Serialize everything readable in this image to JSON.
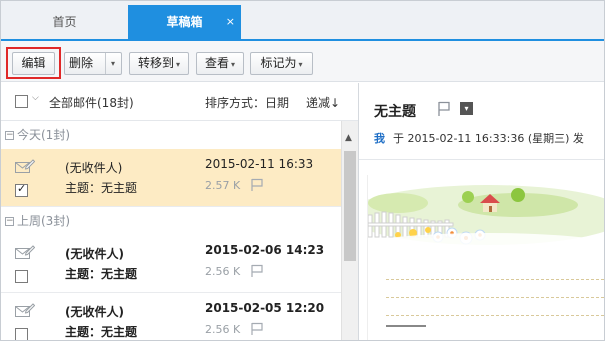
{
  "tabs": {
    "home_label": "首页",
    "drafts_label": "草稿箱",
    "close_glyph": "×"
  },
  "toolbar": {
    "edit_label": "编辑",
    "delete_label": "删除",
    "move_label": "转移到",
    "view_label": "查看",
    "mark_label": "标记为",
    "caret": "▾"
  },
  "list_header": {
    "select_all_label": "全部邮件(18封)",
    "sort_label": "排序方式：日期",
    "order_label": "递减↓"
  },
  "groups": [
    {
      "label": "今天(1封)",
      "toggle": "−"
    },
    {
      "label": "上周(3封)",
      "toggle": "−"
    }
  ],
  "mails": [
    {
      "recipient": "(无收件人)",
      "subject": "主题：无主题",
      "date": "2015-02-11 16:33",
      "size": "2.57 K",
      "checked": true,
      "selected": true,
      "unread": false
    },
    {
      "recipient": "(无收件人)",
      "subject": "主题：无主题",
      "date": "2015-02-06 14:23",
      "size": "2.56 K",
      "checked": false,
      "selected": false,
      "unread": true
    },
    {
      "recipient": "(无收件人)",
      "subject": "主题：无主题",
      "date": "2015-02-05 12:20",
      "size": "2.56 K",
      "checked": false,
      "selected": false,
      "unread": true
    }
  ],
  "preview": {
    "title": "无主题",
    "sender": "我",
    "meta_text": "于 2015-02-11 16:33:36 (星期三) 发",
    "menu_glyph": "▾"
  },
  "colors": {
    "accent": "#1f8fe0",
    "selected_row": "#fdebc4",
    "highlight_border": "#e02828"
  }
}
